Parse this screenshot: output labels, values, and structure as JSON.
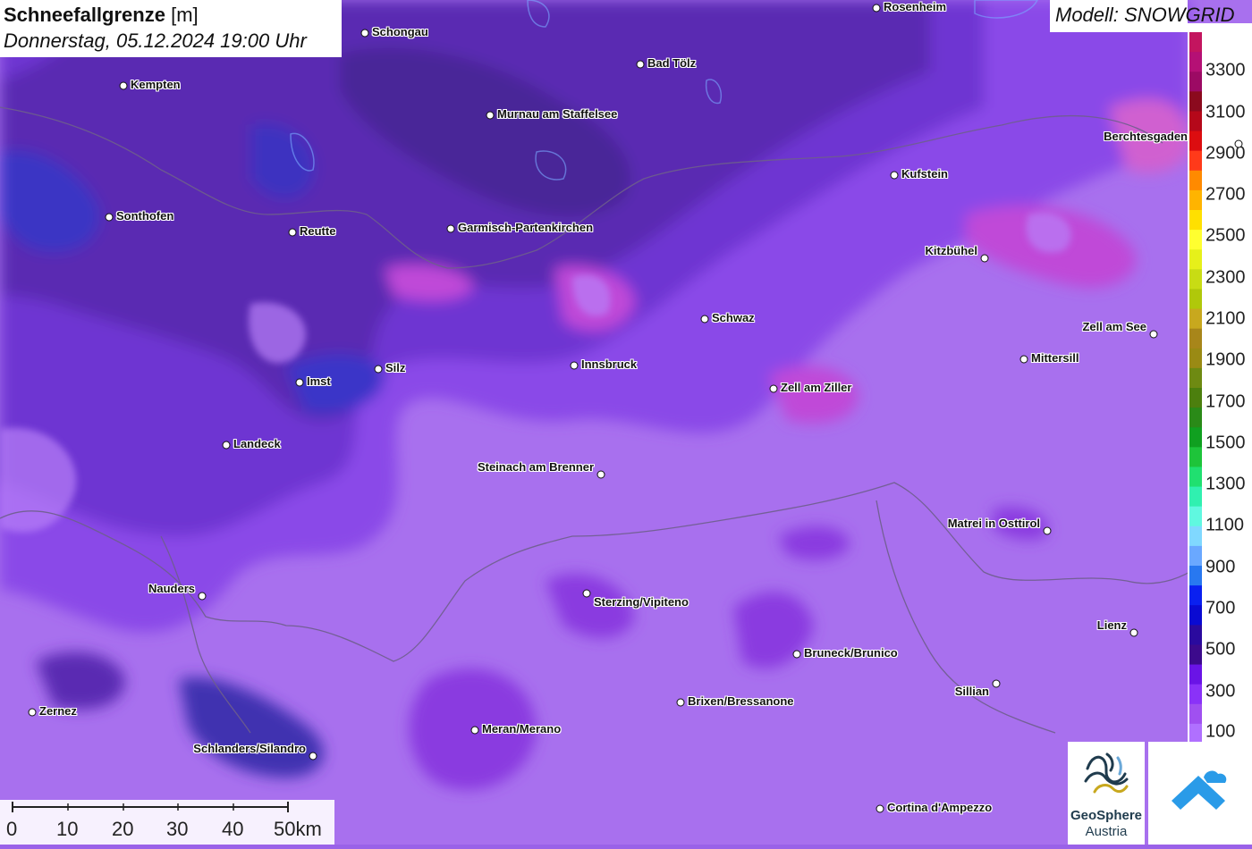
{
  "title": {
    "parameter": "Schneefallgrenze",
    "unit": "[m]",
    "datetime": "Donnerstag, 05.12.2024 19:00 Uhr"
  },
  "model_label": "Modell: SNOWGRID",
  "legend": {
    "labels": [
      "3300",
      "3100",
      "2900",
      "2700",
      "2500",
      "2300",
      "2100",
      "1900",
      "1700",
      "1500",
      "1300",
      "1100",
      "900",
      "700",
      "500",
      "300",
      "100"
    ],
    "colors": [
      "#c3155f",
      "#b51075",
      "#9c0a64",
      "#8b0a1e",
      "#b5081a",
      "#dc0d10",
      "#ff3a1a",
      "#ff8a00",
      "#ffb400",
      "#ffe000",
      "#ffff30",
      "#e6f01a",
      "#c8dc14",
      "#b0c80a",
      "#c8a81e",
      "#a8861a",
      "#9a8a14",
      "#6e8a12",
      "#4c7f0e",
      "#2a8a18",
      "#10a020",
      "#1ec43a",
      "#20e070",
      "#30f0b0",
      "#60f8e0",
      "#80d8ff",
      "#6aa8ff",
      "#2878f0",
      "#0a20f0",
      "#0a0ad2",
      "#2a0a9e",
      "#3c0a8c",
      "#6a14e6",
      "#8a32f8",
      "#a050f0",
      "#b070ff"
    ]
  },
  "cities": [
    {
      "name": "Rosenheim"
    },
    {
      "name": "Schongau"
    },
    {
      "name": "Bad Tölz"
    },
    {
      "name": "Kempten"
    },
    {
      "name": "Murnau am Staffelsee"
    },
    {
      "name": "Berchtesgaden"
    },
    {
      "name": "Kufstein"
    },
    {
      "name": "Sonthofen"
    },
    {
      "name": "Reutte"
    },
    {
      "name": "Garmisch-Partenkirchen"
    },
    {
      "name": "Kitzbühel"
    },
    {
      "name": "Schwaz"
    },
    {
      "name": "Zell am See"
    },
    {
      "name": "Imst"
    },
    {
      "name": "Silz"
    },
    {
      "name": "Innsbruck"
    },
    {
      "name": "Mittersill"
    },
    {
      "name": "Zell am Ziller"
    },
    {
      "name": "Landeck"
    },
    {
      "name": "Steinach am Brenner"
    },
    {
      "name": "Matrei in Osttirol"
    },
    {
      "name": "Nauders"
    },
    {
      "name": "Sterzing/Vipiteno"
    },
    {
      "name": "Lienz"
    },
    {
      "name": "Bruneck/Brunico"
    },
    {
      "name": "Sillian"
    },
    {
      "name": "Brixen/Bressanone"
    },
    {
      "name": "Zernez"
    },
    {
      "name": "Meran/Merano"
    },
    {
      "name": "Schlanders/Silandro"
    },
    {
      "name": "Cortina d'Ampezzo"
    }
  ],
  "scale_bar": {
    "labels": [
      "0",
      "10",
      "20",
      "30",
      "40",
      "50km"
    ]
  },
  "logos": {
    "geosphere_line1": "GeoSphere",
    "geosphere_line2": "Austria"
  },
  "colors": {
    "low_snowline": "#a46cf0",
    "mid_snowline": "#7a3de0",
    "valley_dark": "#4a2aa0",
    "high_magenta": "#c046d8",
    "border": "#7a6a8a"
  }
}
